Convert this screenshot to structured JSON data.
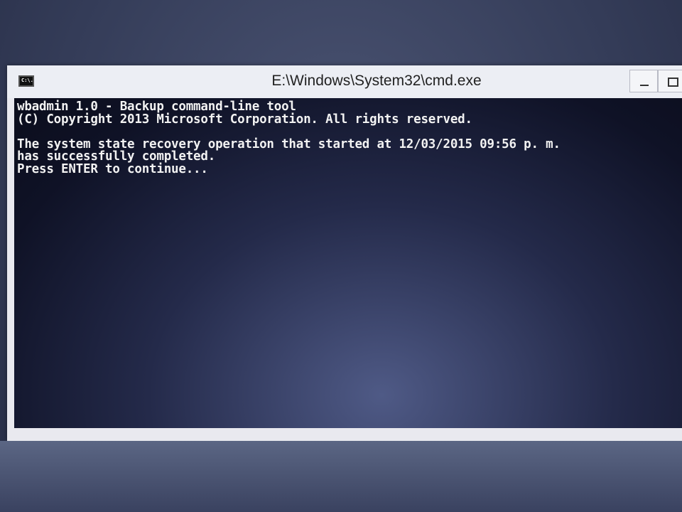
{
  "window": {
    "title": "E:\\Windows\\System32\\cmd.exe",
    "icon_label": "C:\\."
  },
  "console": {
    "lines": [
      "wbadmin 1.0 - Backup command-line tool",
      "(C) Copyright 2013 Microsoft Corporation. All rights reserved.",
      "",
      "The system state recovery operation that started at 12/03/2015 09:56 p. m.",
      "has successfully completed.",
      "Press ENTER to continue..."
    ]
  },
  "colors": {
    "console_text": "#f2f2f2",
    "console_background": "#0f1226",
    "titlebar": "#eceef4"
  }
}
